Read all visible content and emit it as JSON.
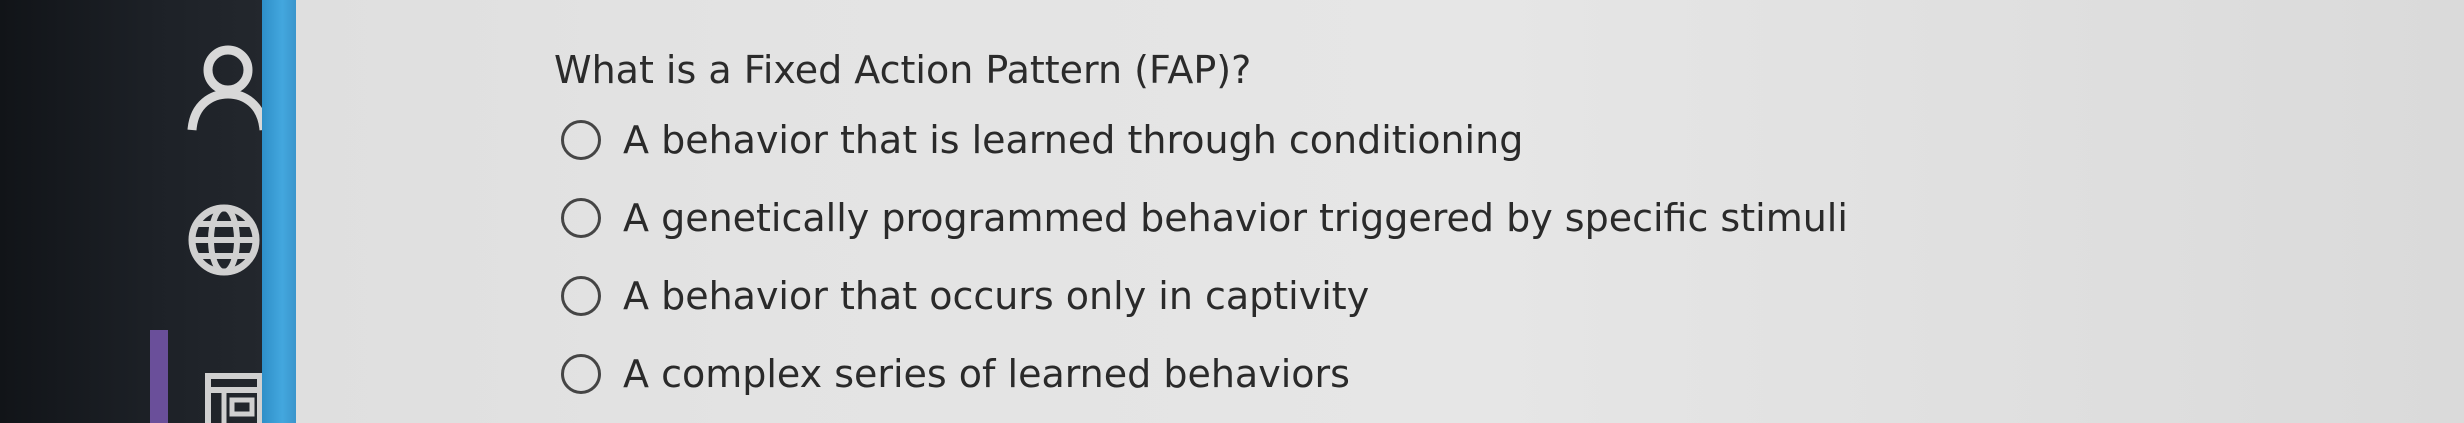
{
  "sidebar": {
    "icons": [
      "user-icon",
      "globe-icon",
      "gradebook-icon"
    ]
  },
  "quiz": {
    "question": "What is a Fixed Action Pattern (FAP)?",
    "options": [
      {
        "label": "A behavior that is learned through conditioning",
        "selected": false
      },
      {
        "label": "A genetically programmed behavior triggered by specific stimuli",
        "selected": false
      },
      {
        "label": "A behavior that occurs only in captivity",
        "selected": false
      },
      {
        "label": "A complex series of learned behaviors",
        "selected": false
      }
    ]
  }
}
